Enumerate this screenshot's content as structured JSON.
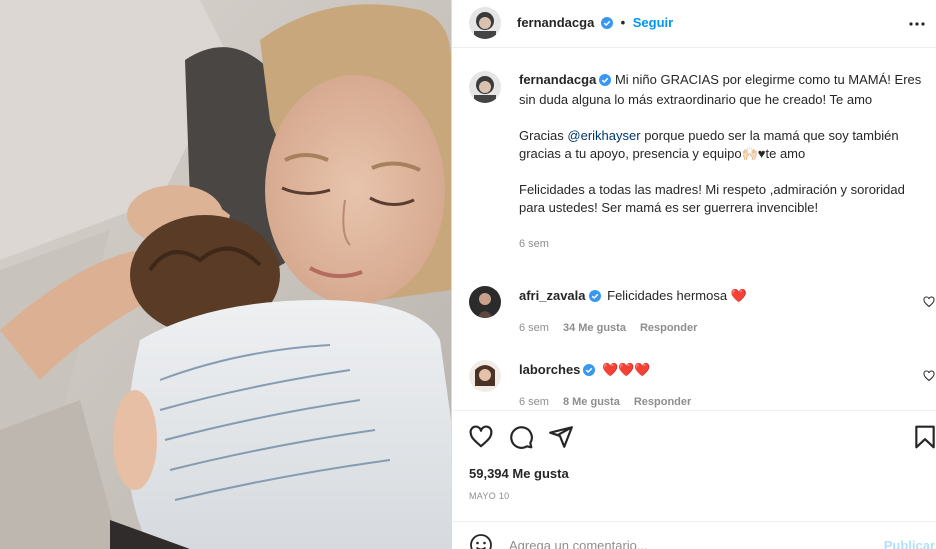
{
  "post": {
    "username": "fernandacga",
    "follow_label": "Seguir",
    "dot": "•"
  },
  "caption": {
    "username": "fernandacga",
    "line1": "Mi niño GRACIAS por elegirme como tu MAMÁ! Eres sin duda alguna lo más extraordinario que he creado! Te amo",
    "line2_pre": "Gracias ",
    "mention": "@erikhayser",
    "line2_post": " porque puedo ser la mamá que soy también gracias a tu apoyo, presencia y equipo🙌🏻♥te amo",
    "line3": "Felicidades a todas las madres! Mi respeto ,admiración y sororidad para ustedes! Ser mamá es ser guerrera invencible!",
    "time": "6 sem"
  },
  "comments": [
    {
      "username": "afri_zavala",
      "text": "Felicidades hermosa ❤️",
      "time": "6 sem",
      "likes": "34 Me gusta",
      "reply": "Responder"
    },
    {
      "username": "laborches",
      "text": "❤️❤️❤️",
      "time": "6 sem",
      "likes": "8 Me gusta",
      "reply": "Responder"
    }
  ],
  "stats": {
    "likes": "59,394 Me gusta",
    "date": "MAYO 10"
  },
  "composer": {
    "placeholder": "Agrega un comentario...",
    "post_label": "Publicar"
  },
  "colors": {
    "accent": "#0095f6",
    "verified": "#3897f0",
    "heart": "#ed1c24",
    "muted": "#8e8e8e"
  },
  "icons": [
    "more-options-icon",
    "verified-icon",
    "heart-icon",
    "comment-icon",
    "share-icon",
    "bookmark-icon",
    "emoji-icon"
  ]
}
